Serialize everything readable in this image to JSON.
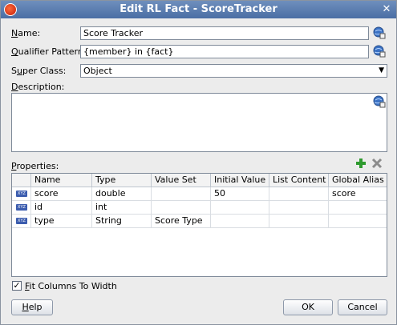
{
  "window": {
    "title": "Edit RL Fact - ScoreTracker"
  },
  "form": {
    "name_label": "Name:",
    "name_value": "Score Tracker",
    "qualifier_label": "Qualifier Pattern:",
    "qualifier_value": "{member} in {fact}",
    "superclass_label": "Super Class:",
    "superclass_value": "Object",
    "description_label": "Description:",
    "description_value": ""
  },
  "properties": {
    "label": "Properties:",
    "columns": [
      "Name",
      "Type",
      "Value Set",
      "Initial Value",
      "List Content T",
      "Global Alias"
    ],
    "rows": [
      {
        "icon": "XYZ",
        "name": "score",
        "type": "double",
        "value_set": "",
        "initial_value": "50",
        "list_content": "",
        "global_alias": "score"
      },
      {
        "icon": "XYZ",
        "name": "id",
        "type": "int",
        "value_set": "",
        "initial_value": "",
        "list_content": "",
        "global_alias": ""
      },
      {
        "icon": "XYZ",
        "name": "type",
        "type": "String",
        "value_set": "Score Type",
        "initial_value": "",
        "list_content": "",
        "global_alias": ""
      }
    ]
  },
  "fit_columns": {
    "label": "Fit Columns To Width",
    "checked": true
  },
  "buttons": {
    "help": "Help",
    "ok": "OK",
    "cancel": "Cancel"
  }
}
